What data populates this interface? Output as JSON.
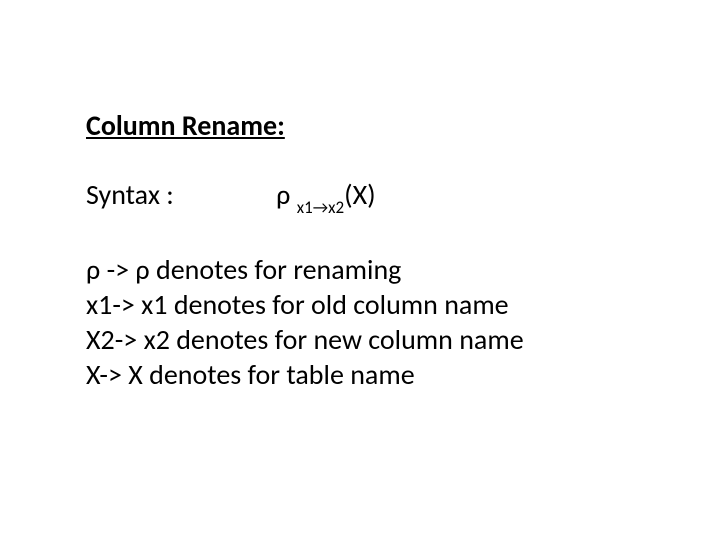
{
  "heading": "Column Rename:",
  "syntax": {
    "label": "Syntax :",
    "rho": "ρ ",
    "sub": "x1→x2",
    "tail": "(X)"
  },
  "lines": {
    "l1": "ρ -> ρ  denotes for renaming",
    "l2": "x1-> x1  denotes  for old column name",
    "l3": "X2-> x2  denotes for new column name",
    "l4": "X-> X denotes for table name"
  }
}
